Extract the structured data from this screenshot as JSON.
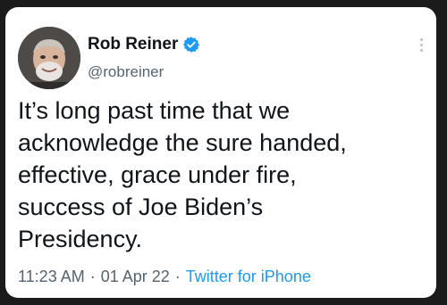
{
  "tweet": {
    "author_name": "Rob Reiner",
    "author_handle": "@robreiner",
    "verified": true,
    "text": "It’s long past time that we\nacknowledge the sure handed,\neffective, grace under fire,\nsuccess of Joe Biden’s\nPresidency.",
    "time": "11:23 AM",
    "separator": "·",
    "date": "01 Apr 22",
    "source": "Twitter for iPhone"
  },
  "icons": {
    "verified": "verified-badge-icon",
    "more": "more-options-icon"
  },
  "colors": {
    "verified_blue": "#1d9bf0",
    "link_blue": "#1d9bf0",
    "muted_gray": "#536471",
    "text_dark": "#0f1419",
    "background": "#1b1b1b"
  }
}
